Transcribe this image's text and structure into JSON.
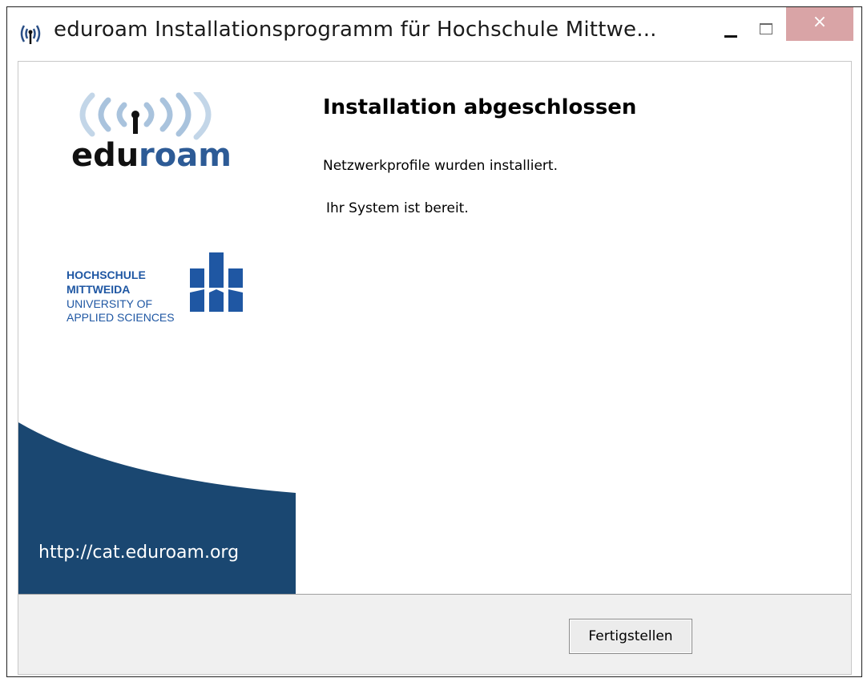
{
  "window": {
    "title": "eduroam Installationsprogramm für Hochschule Mittwe...",
    "icon": "eduroam-antenna-icon",
    "controls": {
      "minimize": "minimize-icon",
      "maximize": "maximize-icon",
      "close_symbol": "×",
      "close_color": "#d9a4a6"
    }
  },
  "sidebar": {
    "eduroam_logo": {
      "text_edu": "edu",
      "text_roam": "roam"
    },
    "university": {
      "line1": "HOCHSCHULE",
      "line2": "MITTWEIDA",
      "line3": "UNIVERSITY OF",
      "line4": "APPLIED SCIENCES",
      "color": "#1f57a3"
    },
    "url": "http://cat.eduroam.org",
    "wave_color": "#1a4771"
  },
  "content": {
    "heading": "Installation abgeschlossen",
    "message1": "Netzwerkprofile wurden installiert.",
    "message2": "Ihr System ist bereit."
  },
  "footer": {
    "finish_label": "Fertigstellen"
  }
}
